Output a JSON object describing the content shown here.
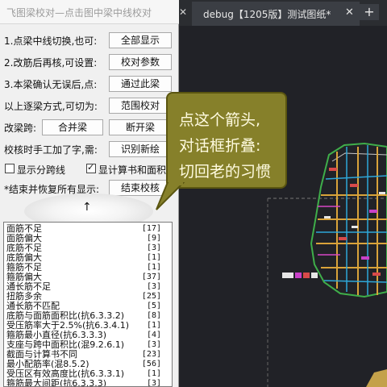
{
  "dialog": {
    "title": "飞图梁校对—点击图中梁中线校对",
    "rows": [
      {
        "label": "1.点梁中线切换,也可:",
        "button": "全部显示"
      },
      {
        "label": "2.改筋后再核,可设置:",
        "button": "校对参数"
      },
      {
        "label": "3.本梁确认无误后,点:",
        "button": "通过此梁"
      },
      {
        "label": "以上逐梁方式,可切为:",
        "button": "范围校对"
      }
    ],
    "modify_label": "改梁跨:",
    "merge_button": "合并梁",
    "split_button": "断开梁",
    "manual_label": "校核时手工加了字,需:",
    "recognize_button": "识别新绘",
    "checkbox_span": {
      "label": "显示分跨线",
      "checked": false
    },
    "checkbox_calc": {
      "label": "显计算书和面积",
      "checked": true
    },
    "restore_label": "*结束并恢复所有显示:",
    "end_button": "结束校核",
    "arrow_glyph": "↑"
  },
  "issues": [
    {
      "text": "面筋不足",
      "count": "[17]"
    },
    {
      "text": "面筋偏大",
      "count": "[9]"
    },
    {
      "text": "底筋不足",
      "count": "[3]"
    },
    {
      "text": "底筋偏大",
      "count": "[1]"
    },
    {
      "text": "箍筋不足",
      "count": "[1]"
    },
    {
      "text": "箍筋偏大",
      "count": "[37]"
    },
    {
      "text": "通长筋不足",
      "count": "[3]"
    },
    {
      "text": "扭筋多余",
      "count": "[25]"
    },
    {
      "text": "通长筋不匹配",
      "count": "[5]"
    },
    {
      "text": "底筋与面筋面积比(抗6.3.3.2)",
      "count": "[8]"
    },
    {
      "text": "受压筋率大于2.5%(抗6.3.4.1)",
      "count": "[1]"
    },
    {
      "text": "箍筋最小直径(抗6.3.3.3)",
      "count": "[4]"
    },
    {
      "text": "支座与跨中面积比(混9.2.6.1)",
      "count": "[3]"
    },
    {
      "text": "截面与计算书不同",
      "count": "[23]"
    },
    {
      "text": "最小配筋率(混8.5.2)",
      "count": "[56]"
    },
    {
      "text": "受压区有效高度比(抗6.3.3.1)",
      "count": "[1]"
    },
    {
      "text": "箍筋最大间距(抗6.3.3.3)",
      "count": "[3]"
    }
  ],
  "tab": {
    "title": "debug【1205版】测试图纸*",
    "close_glyph": "✕",
    "left_close_glyph": "✕"
  },
  "new_tab_glyph": "+",
  "callout": {
    "lines": [
      "点这个箭头,",
      "对话框折叠:",
      "切回老的习惯"
    ]
  },
  "colors": {
    "callout_bg": "#86802a",
    "canvas_bg": "#212227",
    "panel_bg": "#f0f0f0"
  }
}
